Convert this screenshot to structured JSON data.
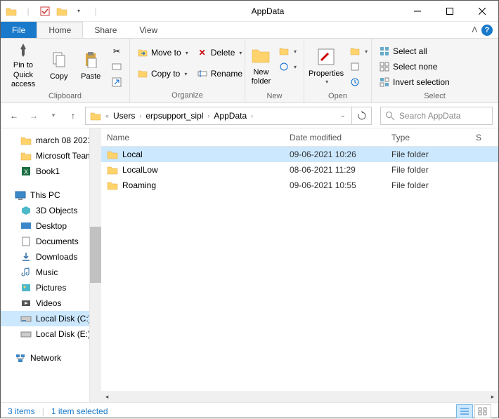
{
  "window": {
    "title": "AppData"
  },
  "tabs": {
    "file": "File",
    "home": "Home",
    "share": "Share",
    "view": "View"
  },
  "ribbon": {
    "clipboard": {
      "label": "Clipboard",
      "pin": "Pin to Quick access",
      "copy": "Copy",
      "paste": "Paste"
    },
    "organize": {
      "label": "Organize",
      "moveto": "Move to",
      "copyto": "Copy to",
      "delete": "Delete",
      "rename": "Rename"
    },
    "new": {
      "label": "New",
      "newfolder": "New folder"
    },
    "open": {
      "label": "Open",
      "properties": "Properties"
    },
    "select": {
      "label": "Select",
      "all": "Select all",
      "none": "Select none",
      "invert": "Invert selection"
    }
  },
  "breadcrumb": {
    "p1": "Users",
    "p2": "erpsupport_sipl",
    "p3": "AppData"
  },
  "search": {
    "placeholder": "Search AppData"
  },
  "sidebar": {
    "quick": [
      {
        "label": "march 08 2021"
      },
      {
        "label": "Microsoft Teams"
      },
      {
        "label": "Book1"
      }
    ],
    "thispc": "This PC",
    "pc": [
      {
        "label": "3D Objects"
      },
      {
        "label": "Desktop"
      },
      {
        "label": "Documents"
      },
      {
        "label": "Downloads"
      },
      {
        "label": "Music"
      },
      {
        "label": "Pictures"
      },
      {
        "label": "Videos"
      },
      {
        "label": "Local Disk (C:)"
      },
      {
        "label": "Local Disk (E:)"
      }
    ],
    "network": "Network"
  },
  "columns": {
    "name": "Name",
    "date": "Date modified",
    "type": "Type",
    "size": "S"
  },
  "rows": [
    {
      "name": "Local",
      "date": "09-06-2021 10:26",
      "type": "File folder",
      "selected": true
    },
    {
      "name": "LocalLow",
      "date": "08-06-2021 11:29",
      "type": "File folder",
      "selected": false
    },
    {
      "name": "Roaming",
      "date": "09-06-2021 10:55",
      "type": "File folder",
      "selected": false
    }
  ],
  "status": {
    "items": "3 items",
    "selected": "1 item selected"
  }
}
